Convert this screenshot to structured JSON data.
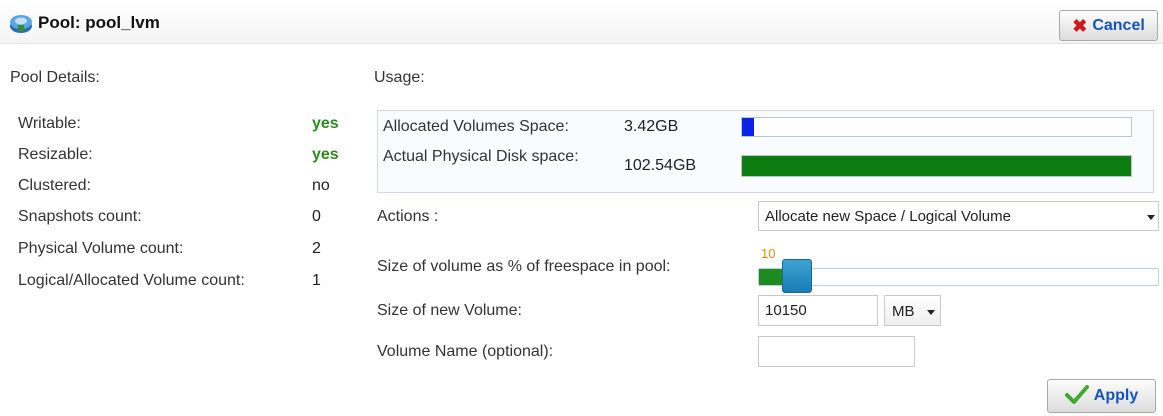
{
  "header": {
    "title": "Pool: pool_lvm",
    "cancel_label": "Cancel"
  },
  "details": {
    "heading": "Pool Details:",
    "rows": [
      {
        "label": "Writable:",
        "value": "yes"
      },
      {
        "label": "Resizable:",
        "value": "yes"
      },
      {
        "label": "Clustered:",
        "value": "no"
      },
      {
        "label": "Snapshots count:",
        "value": "0"
      },
      {
        "label": "Physical Volume count:",
        "value": "2"
      },
      {
        "label": "Logical/Allocated Volume count:",
        "value": "1"
      }
    ]
  },
  "usage": {
    "heading": "Usage:",
    "allocated": {
      "label": "Allocated Volumes Space:",
      "value": "3.42GB",
      "fill_fraction": 0.03
    },
    "physical": {
      "label": "Actual Physical Disk space:",
      "value": "102.54GB",
      "fill_fraction": 1.0
    }
  },
  "form": {
    "actions_label": "Actions :",
    "actions_selected": "Allocate new Space / Logical Volume",
    "size_percent_label": "Size of volume as % of freespace in pool:",
    "size_percent_value": "10",
    "size_percent_fraction": 0.1,
    "new_volume_label": "Size of new Volume:",
    "new_volume_value": "10150",
    "unit_selected": "MB",
    "volume_name_label": "Volume Name (optional):",
    "volume_name_value": "",
    "apply_label": "Apply"
  },
  "colors": {
    "allocated_bar": "#0a24e6",
    "physical_bar": "#0d7d12",
    "slider_fill": "#1f8a1f",
    "yes_text": "#2e8b1f",
    "button_text": "#1655b8"
  },
  "icons": {
    "pool": "pool-disk-icon",
    "cancel": "close-x-icon",
    "apply": "checkmark-icon",
    "dropdown": "chevron-down-icon"
  }
}
